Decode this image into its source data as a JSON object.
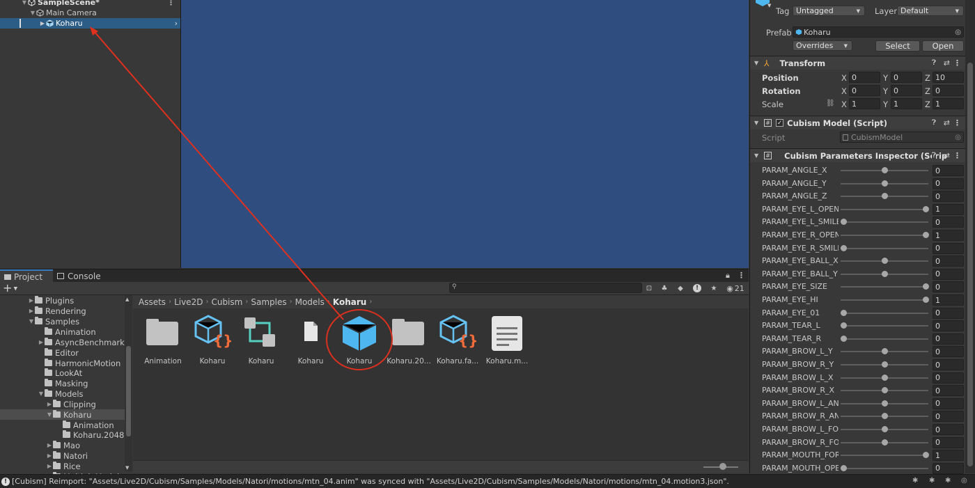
{
  "hierarchy": {
    "items": [
      {
        "label": "SampleScene*"
      },
      {
        "label": "Main Camera"
      },
      {
        "label": "Koharu"
      }
    ]
  },
  "project": {
    "tabs": [
      {
        "label": "Project"
      },
      {
        "label": "Console"
      }
    ],
    "add_label": "+",
    "hidden_count": "21",
    "tree": [
      {
        "label": "Plugins"
      },
      {
        "label": "Rendering"
      },
      {
        "label": "Samples"
      },
      {
        "label": "Animation"
      },
      {
        "label": "AsyncBenchmark"
      },
      {
        "label": "Editor"
      },
      {
        "label": "HarmonicMotion"
      },
      {
        "label": "LookAt"
      },
      {
        "label": "Masking"
      },
      {
        "label": "Models"
      },
      {
        "label": "Clipping"
      },
      {
        "label": "Koharu"
      },
      {
        "label": "Animation"
      },
      {
        "label": "Koharu.2048"
      },
      {
        "label": "Mao"
      },
      {
        "label": "Natori"
      },
      {
        "label": "Rice"
      },
      {
        "label": "MultipleModels"
      }
    ],
    "breadcrumb": [
      "Assets",
      "Live2D",
      "Cubism",
      "Samples",
      "Models",
      "Koharu"
    ],
    "assets": [
      {
        "label": "Animation",
        "icon": "folder-icon"
      },
      {
        "label": "Koharu",
        "icon": "json-cube-icon"
      },
      {
        "label": "Koharu",
        "icon": "node-graph-icon"
      },
      {
        "label": "Koharu",
        "icon": "file-icon"
      },
      {
        "label": "Koharu",
        "icon": "prefab-cube-icon"
      },
      {
        "label": "Koharu.20...",
        "icon": "folder-icon"
      },
      {
        "label": "Koharu.fa...",
        "icon": "json-cube-icon"
      },
      {
        "label": "Koharu.m...",
        "icon": "text-doc-icon"
      }
    ]
  },
  "inspector": {
    "tag_label": "Tag",
    "tag_value": "Untagged",
    "layer_label": "Layer",
    "layer_value": "Default",
    "prefab_label": "Prefab",
    "prefab_value": "Koharu",
    "overrides": "Overrides",
    "select": "Select",
    "open": "Open",
    "transform": {
      "title": "Transform",
      "position": {
        "label": "Position",
        "x": "0",
        "y": "0",
        "z": "10"
      },
      "rotation": {
        "label": "Rotation",
        "x": "0",
        "y": "0",
        "z": "0"
      },
      "scale": {
        "label": "Scale",
        "x": "1",
        "y": "1",
        "z": "1"
      },
      "axes": {
        "x": "X",
        "y": "Y",
        "z": "Z"
      }
    },
    "cubism_model": {
      "title": "Cubism Model (Script)",
      "script_label": "Script",
      "script_value": "CubismModel"
    },
    "params_inspector": {
      "title": "Cubism Parameters Inspector (Scrip"
    },
    "params": [
      {
        "name": "PARAM_ANGLE_X",
        "value": "0",
        "pos": 0.5
      },
      {
        "name": "PARAM_ANGLE_Y",
        "value": "0",
        "pos": 0.5
      },
      {
        "name": "PARAM_ANGLE_Z",
        "value": "0",
        "pos": 0.5
      },
      {
        "name": "PARAM_EYE_L_OPEN",
        "value": "1",
        "pos": 1.0
      },
      {
        "name": "PARAM_EYE_L_SMILE",
        "value": "0",
        "pos": 0.0
      },
      {
        "name": "PARAM_EYE_R_OPEN",
        "value": "1",
        "pos": 1.0
      },
      {
        "name": "PARAM_EYE_R_SMILE",
        "value": "0",
        "pos": 0.0
      },
      {
        "name": "PARAM_EYE_BALL_X",
        "value": "0",
        "pos": 0.5
      },
      {
        "name": "PARAM_EYE_BALL_Y",
        "value": "0",
        "pos": 0.5
      },
      {
        "name": "PARAM_EYE_SIZE",
        "value": "0",
        "pos": 1.0
      },
      {
        "name": "PARAM_EYE_HI",
        "value": "1",
        "pos": 1.0
      },
      {
        "name": "PARAM_EYE_01",
        "value": "0",
        "pos": 0.0
      },
      {
        "name": "PARAM_TEAR_L",
        "value": "0",
        "pos": 0.0
      },
      {
        "name": "PARAM_TEAR_R",
        "value": "0",
        "pos": 0.0
      },
      {
        "name": "PARAM_BROW_L_Y",
        "value": "0",
        "pos": 0.5
      },
      {
        "name": "PARAM_BROW_R_Y",
        "value": "0",
        "pos": 0.5
      },
      {
        "name": "PARAM_BROW_L_X",
        "value": "0",
        "pos": 0.5
      },
      {
        "name": "PARAM_BROW_R_X",
        "value": "0",
        "pos": 0.5
      },
      {
        "name": "PARAM_BROW_L_ANGLE",
        "value": "0",
        "pos": 0.5
      },
      {
        "name": "PARAM_BROW_R_ANGLE",
        "value": "0",
        "pos": 0.5
      },
      {
        "name": "PARAM_BROW_L_FORM",
        "value": "0",
        "pos": 0.5
      },
      {
        "name": "PARAM_BROW_R_FORM",
        "value": "0",
        "pos": 0.5
      },
      {
        "name": "PARAM_MOUTH_FORM",
        "value": "1",
        "pos": 1.0
      },
      {
        "name": "PARAM_MOUTH_OPEN_Y",
        "value": "0",
        "pos": 0.0
      }
    ]
  },
  "status_bar": {
    "message": "[Cubism] Reimport: \"Assets/Live2D/Cubism/Samples/Models/Natori/motions/mtn_04.anim\" was synced with \"Assets/Live2D/Cubism/Samples/Models/Natori/motions/mtn_04.motion3.json\"."
  },
  "colors": {
    "scene_bg": "#2f4e7f",
    "selection": "#2c5d87",
    "arrow": "#e0301e",
    "json_accent": "#f26b3a",
    "cube_blue": "#4fb7f0"
  }
}
